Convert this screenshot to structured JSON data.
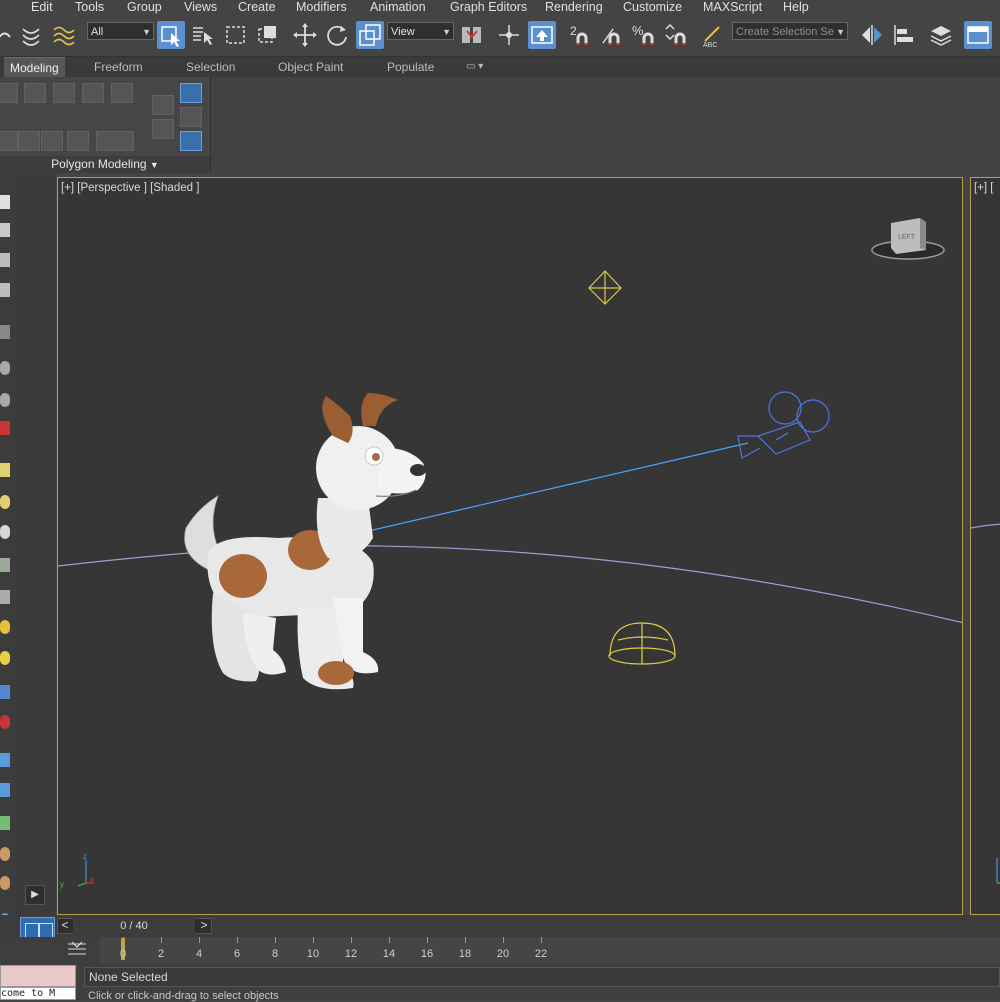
{
  "menu": [
    "Edit",
    "Tools",
    "Group",
    "Views",
    "Create",
    "Modifiers",
    "Animation",
    "Graph Editors",
    "Rendering",
    "Customize",
    "MAXScript",
    "Help"
  ],
  "toolbar": {
    "selection_filter": "All",
    "reference_coord": "View",
    "named_selection_set": "Create Selection Se"
  },
  "ribbon": {
    "tabs": [
      "Modeling",
      "Freeform",
      "Selection",
      "Object Paint",
      "Populate"
    ],
    "active_tab": "Modeling",
    "panel_label": "Polygon Modeling"
  },
  "viewport": {
    "label": "[+] [Perspective ] [Shaded ]",
    "second_label": "[+] ["
  },
  "viewcube_face": "LEFT",
  "time_slider": {
    "value": "0 / 40",
    "prev": "<",
    "next": ">"
  },
  "trackbar": {
    "ticks": [
      "0",
      "2",
      "4",
      "6",
      "8",
      "10",
      "12",
      "14",
      "16",
      "18",
      "20",
      "22"
    ]
  },
  "status": {
    "selection": "None Selected",
    "prompt": "Click or click-and-drag to select objects",
    "maxscript": "come to M"
  },
  "axis_labels": {
    "x": "x",
    "y": "y",
    "z": "z"
  }
}
